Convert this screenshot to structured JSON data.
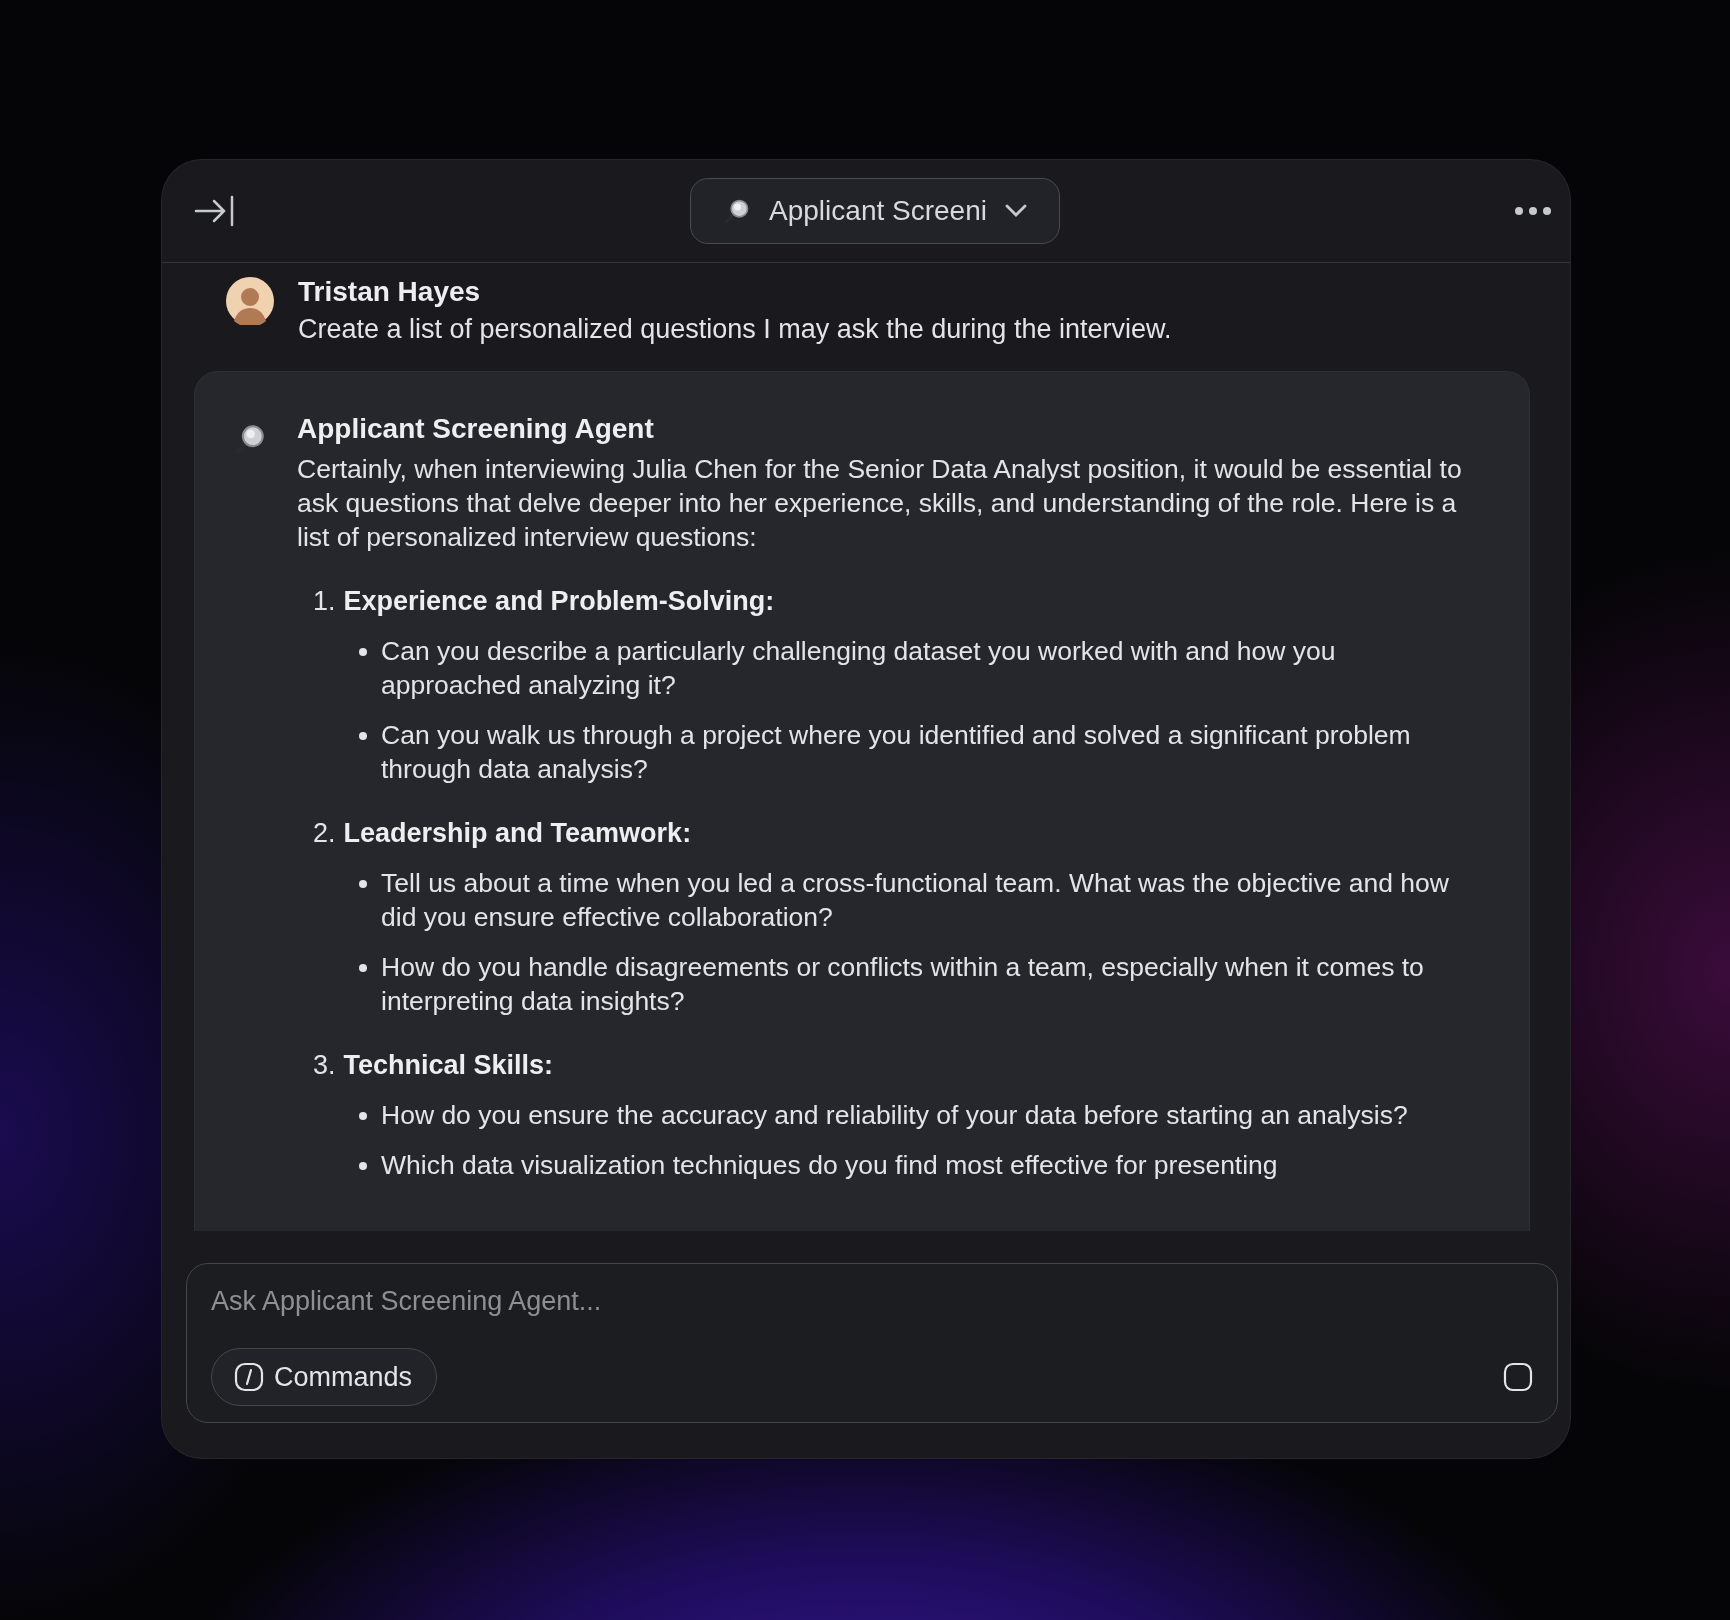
{
  "header": {
    "title": "Applicant Screeni"
  },
  "user_message": {
    "name": "Tristan Hayes",
    "text": "Create a list of personalized questions I may ask the during the interview."
  },
  "agent_message": {
    "name": "Applicant Screening Agent",
    "intro": "Certainly, when interviewing Julia Chen for the Senior Data Analyst position, it would be essential to ask questions that delve deeper into her experience, skills, and understanding of the role. Here is a list of personalized interview questions:",
    "sections": [
      {
        "number": "1.",
        "heading": "Experience and Problem-Solving:",
        "questions": [
          "Can you describe a particularly challenging dataset you worked with and how you approached analyzing it?",
          "Can you walk us through a project where you identified and solved a significant problem through data analysis?"
        ]
      },
      {
        "number": "2.",
        "heading": "Leadership and Teamwork:",
        "questions": [
          "Tell us about a time when you led a cross-functional team. What was the objective and how did you ensure effective collaboration?",
          "How do you handle disagreements or conflicts within a team, especially when it comes to interpreting data insights?"
        ]
      },
      {
        "number": "3.",
        "heading": "Technical Skills:",
        "questions": [
          "How do you ensure the accuracy and reliability of your data before starting an analysis?",
          "Which data visualization techniques do you find most effective for presenting"
        ]
      }
    ]
  },
  "composer": {
    "placeholder": "Ask Applicant Screening Agent...",
    "commands_button": "Commands"
  }
}
